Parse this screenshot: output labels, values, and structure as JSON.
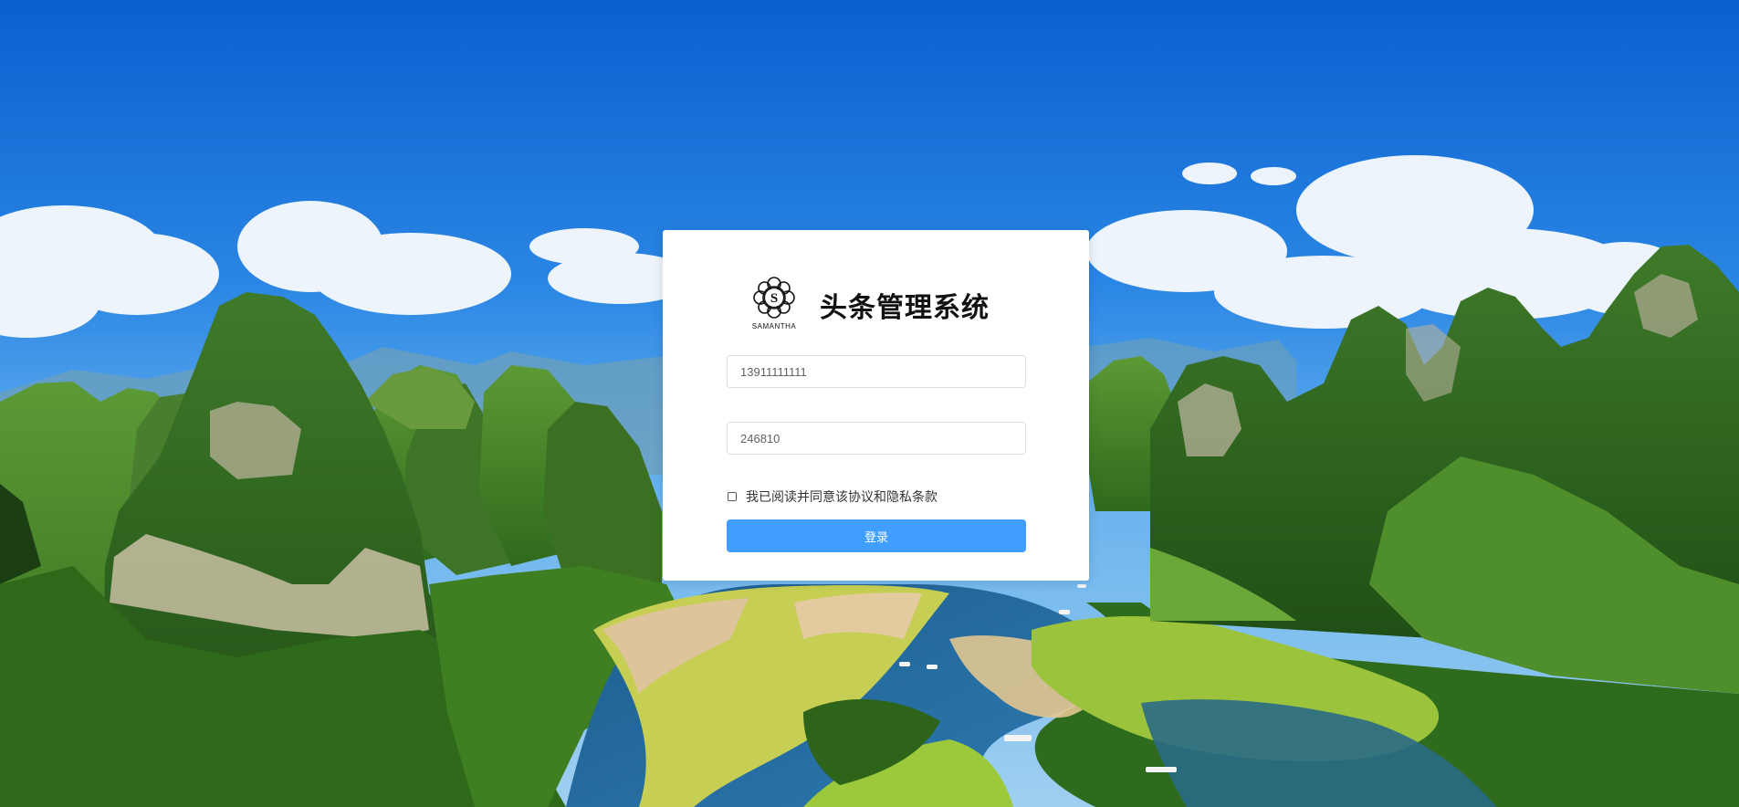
{
  "app": {
    "title": "头条管理系统",
    "logo_text": "SAMANTHA",
    "logo_letter": "S"
  },
  "form": {
    "phone_value": "13911111111",
    "code_value": "246810",
    "agreement_label": "我已阅读并同意该协议和隐私条款",
    "agreement_checked": false,
    "login_label": "登录"
  },
  "colors": {
    "primary": "#409eff",
    "card": "#ffffff"
  },
  "background": {
    "description_icon": "landscape-photo"
  }
}
